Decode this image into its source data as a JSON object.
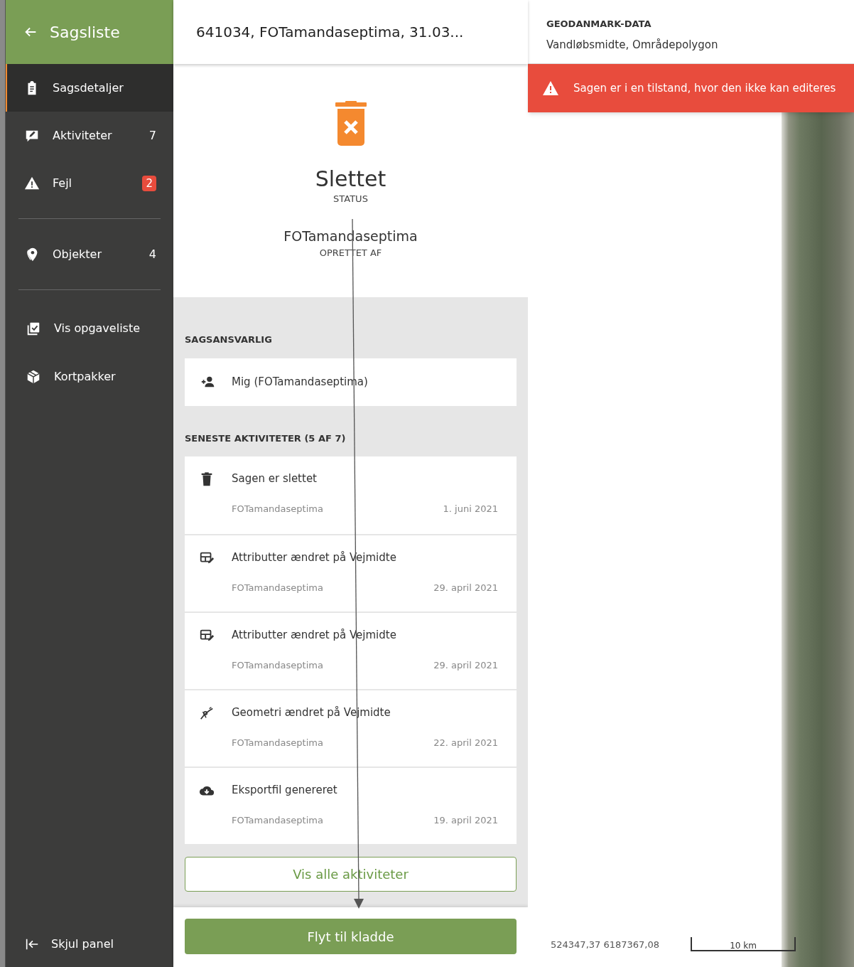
{
  "sidebar": {
    "back_label": "Sagsliste",
    "items": [
      {
        "label": "Sagsdetaljer",
        "kind": "plain",
        "selected": true
      },
      {
        "label": "Aktiviteter",
        "kind": "count",
        "count": "7",
        "selected": false
      },
      {
        "label": "Fejl",
        "kind": "badge",
        "count": "2",
        "selected": false
      },
      {
        "label": "Objekter",
        "kind": "count",
        "count": "4",
        "selected": false
      }
    ],
    "tools": [
      {
        "label": "Vis opgaveliste"
      },
      {
        "label": "Kortpakker"
      }
    ],
    "collapse_label": "Skjul panel"
  },
  "case": {
    "title": "641034, FOTamandaseptima, 31.03...",
    "status": "Slettet",
    "status_label": "STATUS",
    "creator": "FOTamandaseptima",
    "creator_label": "OPRETTET AF",
    "responsible_heading": "SAGSANSVARLIG",
    "responsible": "Mig (FOTamandaseptima)",
    "activities_heading": "SENESTE AKTIVITETER (5 AF 7)",
    "activities": [
      {
        "kind": "delete",
        "title": "Sagen er slettet",
        "user": "FOTamandaseptima",
        "date": "1. juni 2021"
      },
      {
        "kind": "attributes",
        "title": "Attributter ændret på Vejmidte",
        "user": "FOTamandaseptima",
        "date": "29. april 2021"
      },
      {
        "kind": "attributes",
        "title": "Attributter ændret på Vejmidte",
        "user": "FOTamandaseptima",
        "date": "29. april 2021"
      },
      {
        "kind": "geometry",
        "title": "Geometri ændret på Vejmidte",
        "user": "FOTamandaseptima",
        "date": "22. april 2021"
      },
      {
        "kind": "export",
        "title": "Eksportfil genereret",
        "user": "FOTamandaseptima",
        "date": "19. april 2021"
      }
    ],
    "show_all_button": "Vis alle aktiviteter",
    "primary_button": "Flyt til kladde"
  },
  "map": {
    "info_heading": "GEODANMARK-DATA",
    "info_text": "Vandløbsmidte, Områdepolygon",
    "alert": "Sagen er i en tilstand, hvor den ikke kan editeres",
    "coordinates": "524347,37 6187367,08",
    "scale": "10 km"
  }
}
